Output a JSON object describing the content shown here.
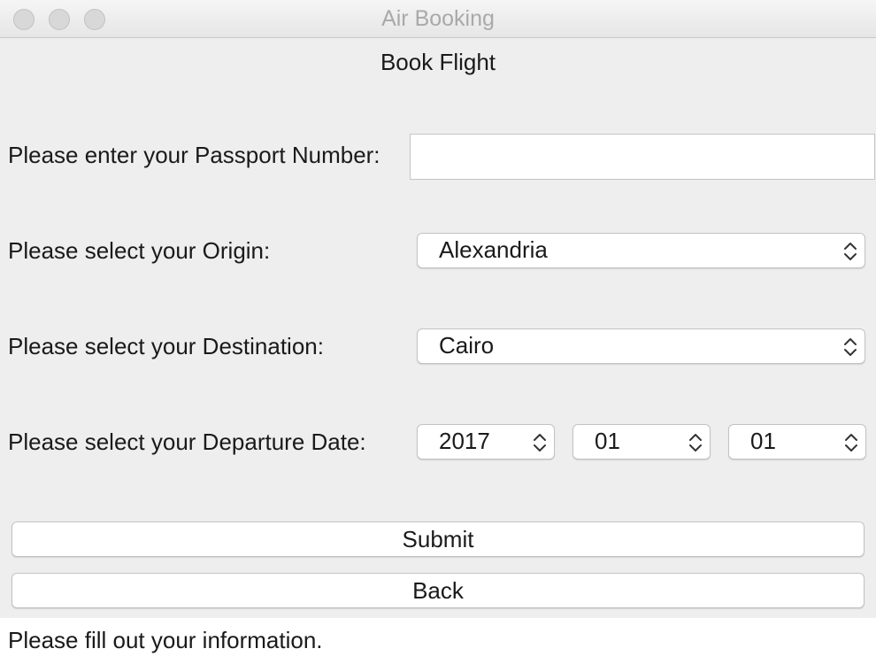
{
  "window": {
    "title": "Air Booking"
  },
  "form": {
    "heading": "Book Flight",
    "passport": {
      "label": "Please enter your Passport Number:",
      "value": ""
    },
    "origin": {
      "label": "Please select your Origin:",
      "selected": "Alexandria"
    },
    "destination": {
      "label": "Please select your Destination:",
      "selected": "Cairo"
    },
    "departure": {
      "label": "Please select your Departure Date:",
      "year": "2017",
      "month": "01",
      "day": "01"
    },
    "submit_label": "Submit",
    "back_label": "Back"
  },
  "status": {
    "message": "Please fill out your information."
  },
  "icons": {
    "window_controls": [
      "close-icon",
      "minimize-icon",
      "zoom-icon"
    ],
    "select_indicator": "chevron-up-down-icon"
  },
  "colors": {
    "window_background": "#eeeeee",
    "field_background": "#ffffff",
    "title_text": "#a9a9a9",
    "text": "#1a1a1a"
  }
}
